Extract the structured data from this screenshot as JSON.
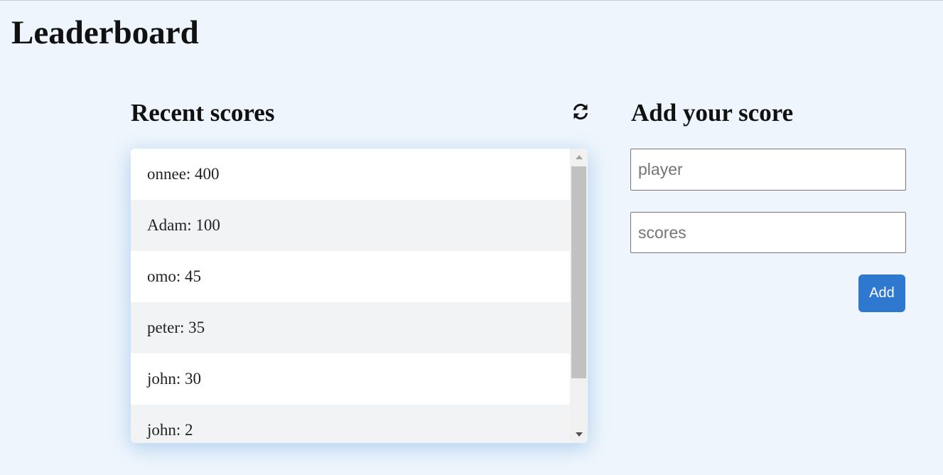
{
  "header": {
    "title": "Leaderboard"
  },
  "recent": {
    "title": "Recent scores",
    "refresh_icon": "refresh-icon",
    "scores": [
      {
        "text": "onnee: 400"
      },
      {
        "text": "Adam: 100"
      },
      {
        "text": "omo: 45"
      },
      {
        "text": "peter: 35"
      },
      {
        "text": "john: 30"
      },
      {
        "text": "john: 2"
      }
    ]
  },
  "form": {
    "title": "Add your score",
    "player_placeholder": "player",
    "scores_placeholder": "scores",
    "submit_label": "Add"
  },
  "colors": {
    "background": "#eef5fc",
    "accent": "#2e78d0",
    "row_alt": "#f2f3f4"
  }
}
